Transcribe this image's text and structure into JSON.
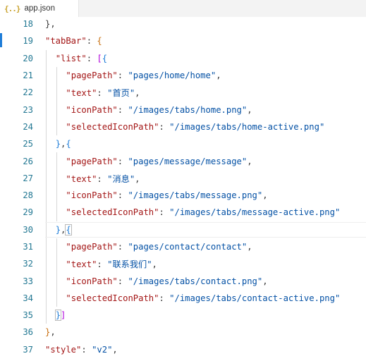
{
  "tab": {
    "icon": "{..}",
    "filename": "app.json"
  },
  "lines": [
    {
      "n": "18",
      "indent": 2,
      "tokens": [
        [
          "p",
          "},"
        ]
      ]
    },
    {
      "n": "19",
      "indent": 2,
      "tokens": [
        [
          "k",
          "\"tabBar\""
        ],
        [
          "p",
          ": "
        ],
        [
          "b1",
          "{"
        ]
      ]
    },
    {
      "n": "20",
      "indent": 4,
      "tokens": [
        [
          "k",
          "\"list\""
        ],
        [
          "p",
          ": "
        ],
        [
          "b2",
          "["
        ],
        [
          "b3",
          "{"
        ]
      ]
    },
    {
      "n": "21",
      "indent": 6,
      "tokens": [
        [
          "k",
          "\"pagePath\""
        ],
        [
          "p",
          ": "
        ],
        [
          "s",
          "\"pages/home/home\""
        ],
        [
          "p",
          ","
        ]
      ]
    },
    {
      "n": "22",
      "indent": 6,
      "tokens": [
        [
          "k",
          "\"text\""
        ],
        [
          "p",
          ": "
        ],
        [
          "s",
          "\"首页\""
        ],
        [
          "p",
          ","
        ]
      ]
    },
    {
      "n": "23",
      "indent": 6,
      "tokens": [
        [
          "k",
          "\"iconPath\""
        ],
        [
          "p",
          ": "
        ],
        [
          "s",
          "\"/images/tabs/home.png\""
        ],
        [
          "p",
          ","
        ]
      ]
    },
    {
      "n": "24",
      "indent": 6,
      "tokens": [
        [
          "k",
          "\"selectedIconPath\""
        ],
        [
          "p",
          ": "
        ],
        [
          "s",
          "\"/images/tabs/home-active.png\""
        ]
      ]
    },
    {
      "n": "25",
      "indent": 4,
      "tokens": [
        [
          "b3",
          "}"
        ],
        [
          "p",
          ","
        ],
        [
          "b3",
          "{"
        ]
      ]
    },
    {
      "n": "26",
      "indent": 6,
      "tokens": [
        [
          "k",
          "\"pagePath\""
        ],
        [
          "p",
          ": "
        ],
        [
          "s",
          "\"pages/message/message\""
        ],
        [
          "p",
          ","
        ]
      ]
    },
    {
      "n": "27",
      "indent": 6,
      "tokens": [
        [
          "k",
          "\"text\""
        ],
        [
          "p",
          ": "
        ],
        [
          "s",
          "\"消息\""
        ],
        [
          "p",
          ","
        ]
      ]
    },
    {
      "n": "28",
      "indent": 6,
      "tokens": [
        [
          "k",
          "\"iconPath\""
        ],
        [
          "p",
          ": "
        ],
        [
          "s",
          "\"/images/tabs/message.png\""
        ],
        [
          "p",
          ","
        ]
      ]
    },
    {
      "n": "29",
      "indent": 6,
      "tokens": [
        [
          "k",
          "\"selectedIconPath\""
        ],
        [
          "p",
          ": "
        ],
        [
          "s",
          "\"/images/tabs/message-active.png\""
        ]
      ]
    },
    {
      "n": "30",
      "indent": 4,
      "tokens": [
        [
          "b3",
          "}"
        ],
        [
          "p",
          ","
        ],
        [
          "b3",
          "{"
        ]
      ]
    },
    {
      "n": "31",
      "indent": 6,
      "tokens": [
        [
          "k",
          "\"pagePath\""
        ],
        [
          "p",
          ": "
        ],
        [
          "s",
          "\"pages/contact/contact\""
        ],
        [
          "p",
          ","
        ]
      ]
    },
    {
      "n": "32",
      "indent": 6,
      "tokens": [
        [
          "k",
          "\"text\""
        ],
        [
          "p",
          ": "
        ],
        [
          "s",
          "\"联系我们\""
        ],
        [
          "p",
          ","
        ]
      ]
    },
    {
      "n": "33",
      "indent": 6,
      "tokens": [
        [
          "k",
          "\"iconPath\""
        ],
        [
          "p",
          ": "
        ],
        [
          "s",
          "\"/images/tabs/contact.png\""
        ],
        [
          "p",
          ","
        ]
      ]
    },
    {
      "n": "34",
      "indent": 6,
      "tokens": [
        [
          "k",
          "\"selectedIconPath\""
        ],
        [
          "p",
          ": "
        ],
        [
          "s",
          "\"/images/tabs/contact-active.png\""
        ]
      ]
    },
    {
      "n": "35",
      "indent": 4,
      "tokens": [
        [
          "b3",
          "}"
        ],
        [
          "b2",
          "]"
        ]
      ]
    },
    {
      "n": "36",
      "indent": 2,
      "tokens": [
        [
          "b1",
          "}"
        ],
        [
          "p",
          ","
        ]
      ]
    },
    {
      "n": "37",
      "indent": 2,
      "tokens": [
        [
          "k",
          "\"style\""
        ],
        [
          "p",
          ": "
        ],
        [
          "s",
          "\"v2\""
        ],
        [
          "p",
          ","
        ]
      ]
    }
  ]
}
